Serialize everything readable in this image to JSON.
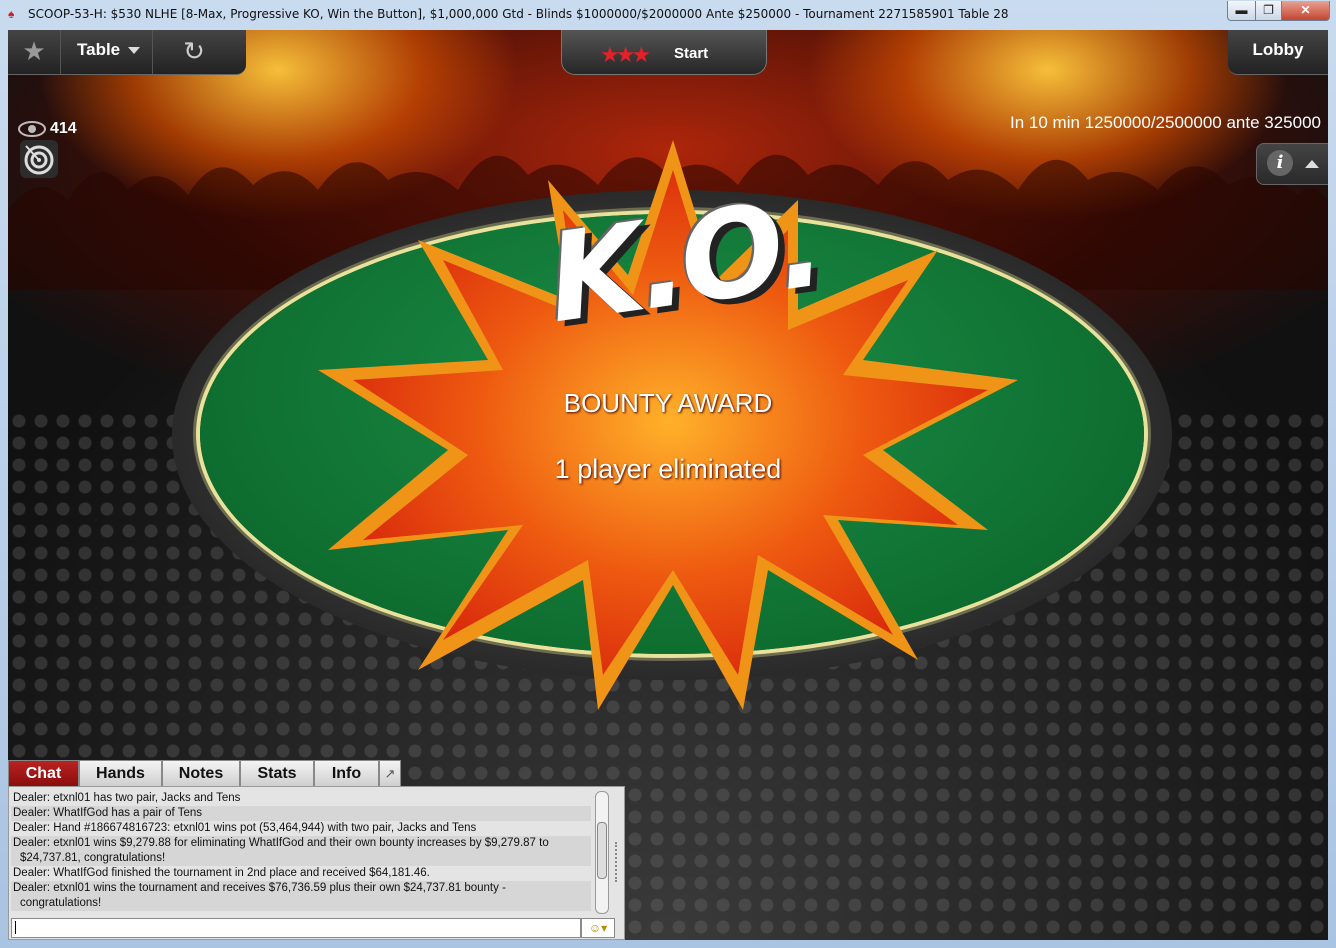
{
  "window": {
    "title": "SCOOP-53-H: $530 NLHE [8-Max, Progressive KO, Win the Button], $1,000,000 Gtd - Blinds $1000000/$2000000 Ante $250000 - Tournament 2271585901 Table 28",
    "icon": "pokerstars-spade-icon",
    "minimize": "▬",
    "maximize": "❐",
    "close": "✕"
  },
  "toolbar": {
    "star_icon": "★",
    "table_label": "Table",
    "reload_icon": "↻",
    "start_label": "Start",
    "start_stars": "★★★",
    "lobby_label": "Lobby"
  },
  "status": {
    "observers": "414",
    "next_blinds": "In 10 min 1250000/2500000 ante 325000",
    "info_icon": "i"
  },
  "overlay": {
    "ko_text": "K.O.",
    "title": "BOUNTY AWARD",
    "subtitle": "1 player eliminated"
  },
  "tabs": [
    {
      "label": "Chat",
      "active": true
    },
    {
      "label": "Hands"
    },
    {
      "label": "Notes"
    },
    {
      "label": "Stats"
    },
    {
      "label": "Info"
    },
    {
      "label": "↗"
    }
  ],
  "chat": {
    "lines": [
      {
        "text": "Dealer: etxnl01 has two pair, Jacks and Tens"
      },
      {
        "text": "Dealer: WhatIfGod has a pair of Tens"
      },
      {
        "text": "Dealer: Hand #186674816723: etxnl01 wins pot (53,464,944) with two pair, Jacks and Tens"
      },
      {
        "text": "Dealer: etxnl01 wins $9,279.88 for eliminating WhatIfGod and their own bounty increases by $9,279.87 to",
        "cont": "$24,737.81, congratulations!"
      },
      {
        "text": "Dealer: WhatIfGod finished the tournament in 2nd place and received $64,181.46."
      },
      {
        "text": "Dealer: etxnl01 wins the tournament and receives $76,736.59 plus their own $24,737.81 bounty -",
        "cont": "congratulations!"
      }
    ],
    "input_value": "",
    "emoji_icon": "☺▾"
  }
}
